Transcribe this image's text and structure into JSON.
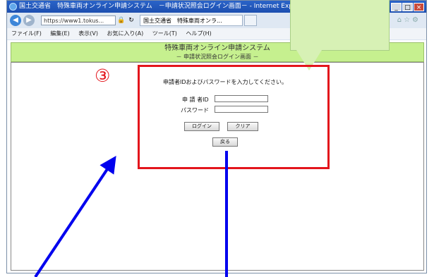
{
  "window": {
    "title": "国土交通省　特殊車両オンライン申請システム　－申請状況照会ログイン画面－ - Internet Explorer",
    "url": "https://www1.tokus...",
    "tab_label": "国土交通省　特殊車両オンラ...",
    "min_label": "_",
    "max_label": "□",
    "close_label": "×"
  },
  "menu": {
    "items": [
      "ファイル(F)",
      "編集(E)",
      "表示(V)",
      "お気に入り(A)",
      "ツール(T)",
      "ヘルプ(H)"
    ]
  },
  "page": {
    "header_title": "特殊車両オンライン申請システム",
    "header_subtitle": "－ 申請状況照会ログイン画面 －",
    "prompt": "申請者IDおよびパスワードを入力してください。",
    "applicant_id_label": "申 請 者ID",
    "password_label": "パスワード",
    "login_button": "ログイン",
    "clear_button": "クリア",
    "back_button": "戻る"
  },
  "annotation": {
    "step_number": "③",
    "accent_color": "#e3151c",
    "arrow_color": "#0000ee",
    "callout_color": "#d7f1b5"
  }
}
